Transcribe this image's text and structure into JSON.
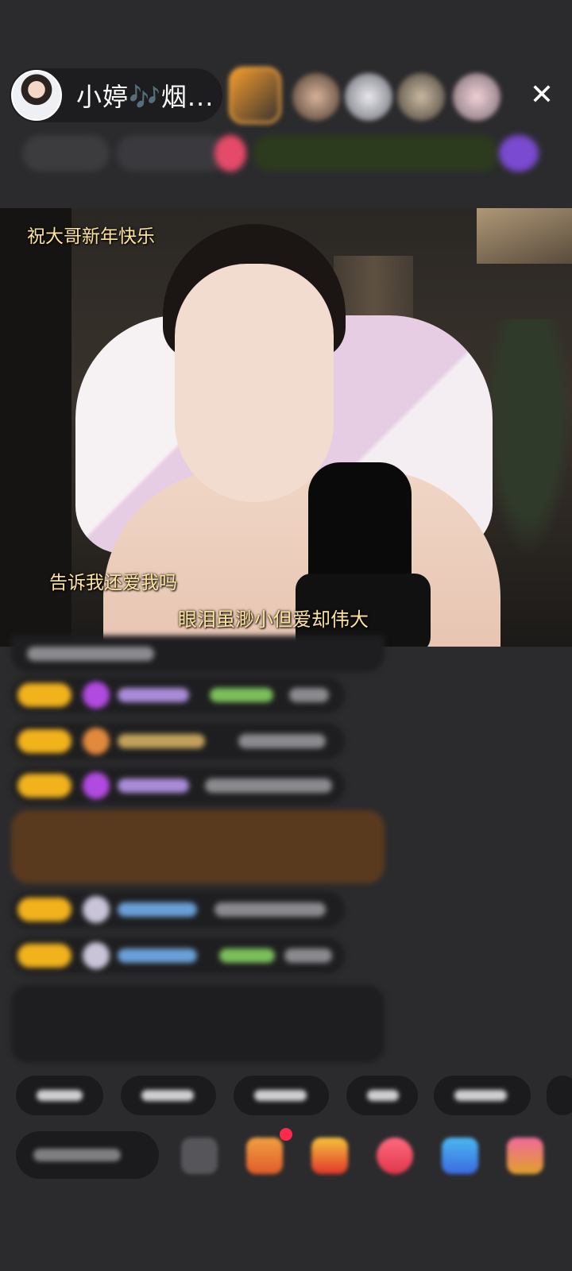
{
  "host": {
    "name": "小婷🎶烟..."
  },
  "video": {
    "overlay_top": "祝大哥新年快乐",
    "overlay_mid": "告诉我还爱我吗",
    "overlay_bottom": "眼泪虽渺小但爱却伟大"
  },
  "colors": {
    "background": "#2b2b2d",
    "overlay_text": "#ffe39a",
    "level_badge": "#f1b21c",
    "gift_highlight": "#5a3a1e",
    "notice_green": "#9fd46a"
  },
  "icons": {
    "close": "close-icon",
    "input_more": "chevron-right-icon",
    "bottom": [
      "emoji-icon",
      "gift-box-icon",
      "treasure-icon",
      "heart-gift-icon",
      "game-icon",
      "shop-icon"
    ]
  }
}
